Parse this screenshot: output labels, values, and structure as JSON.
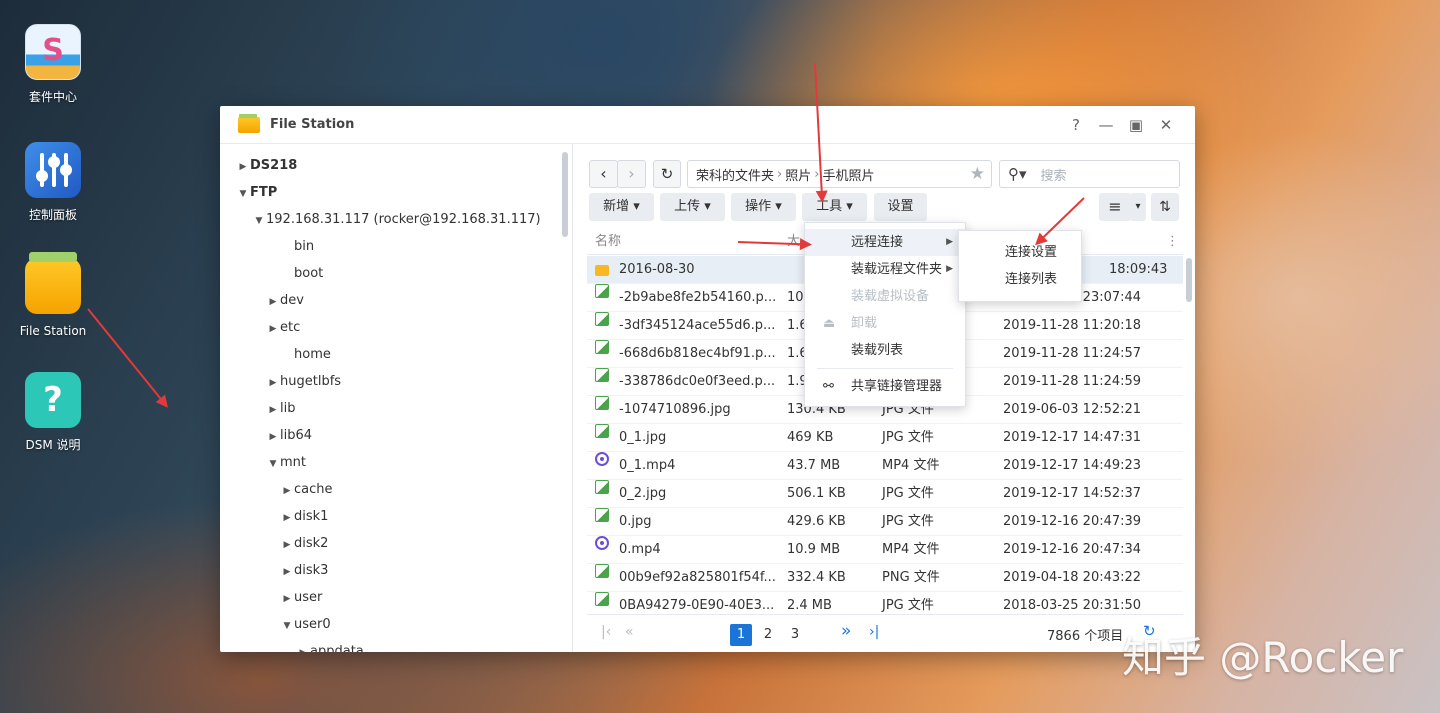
{
  "desktop": {
    "icons": [
      {
        "label": "套件中心",
        "icon": "package-center-icon"
      },
      {
        "label": "控制面板",
        "icon": "control-panel-icon"
      },
      {
        "label": "File Station",
        "icon": "folder-icon"
      },
      {
        "label": "DSM 说明",
        "icon": "help-icon"
      }
    ]
  },
  "window": {
    "title": "File Station",
    "controls": {
      "help": "?",
      "minimize": "—",
      "maximize": "▣",
      "close": "✕"
    }
  },
  "sidebar": {
    "items": [
      {
        "label": "DS218",
        "arrow": "▶"
      },
      {
        "label": "FTP",
        "arrow": "▼"
      },
      {
        "label": "192.168.31.117 (rocker@192.168.31.117)",
        "arrow": "▼"
      },
      {
        "label": "bin",
        "arrow": ""
      },
      {
        "label": "boot",
        "arrow": ""
      },
      {
        "label": "dev",
        "arrow": "▶"
      },
      {
        "label": "etc",
        "arrow": "▶"
      },
      {
        "label": "home",
        "arrow": ""
      },
      {
        "label": "hugetlbfs",
        "arrow": "▶"
      },
      {
        "label": "lib",
        "arrow": "▶"
      },
      {
        "label": "lib64",
        "arrow": "▶"
      },
      {
        "label": "mnt",
        "arrow": "▼"
      },
      {
        "label": "cache",
        "arrow": "▶"
      },
      {
        "label": "disk1",
        "arrow": "▶"
      },
      {
        "label": "disk2",
        "arrow": "▶"
      },
      {
        "label": "disk3",
        "arrow": "▶"
      },
      {
        "label": "user",
        "arrow": "▶"
      },
      {
        "label": "user0",
        "arrow": "▼"
      },
      {
        "label": "appdata",
        "arrow": "▶"
      }
    ]
  },
  "toolbar": {
    "back": "‹",
    "forward": "›",
    "refresh": "↻",
    "path": [
      "荣科的文件夹",
      "照片",
      "手机照片"
    ],
    "path_sep": "›",
    "star": "★",
    "search_placeholder": "搜索",
    "create": "新增 ▾",
    "upload": "上传 ▾",
    "action": "操作 ▾",
    "tools": "工具 ▾",
    "settings": "设置",
    "view_list": "≡",
    "view_dropdown": "▾",
    "sort": "⇅"
  },
  "table": {
    "columns": {
      "name": "名称",
      "size": "大",
      "more": "⋮"
    },
    "rows": [
      {
        "name": "2016-08-30",
        "size": "",
        "type": "",
        "modified": "18:09:43",
        "kind": "dir"
      },
      {
        "name": "-2b9abe8fe2b54160.p...",
        "size": "10",
        "type": "",
        "modified": "2019-11-03 23:07:44",
        "kind": "img"
      },
      {
        "name": "-3df345124ace55d6.p...",
        "size": "1.6",
        "type": "",
        "modified": "2019-11-28 11:20:18",
        "kind": "img"
      },
      {
        "name": "-668d6b818ec4bf91.p...",
        "size": "1.6",
        "type": "",
        "modified": "2019-11-28 11:24:57",
        "kind": "img"
      },
      {
        "name": "-338786dc0e0f3eed.p...",
        "size": "1.9",
        "type": "",
        "modified": "2019-11-28 11:24:59",
        "kind": "img"
      },
      {
        "name": "-1074710896.jpg",
        "size": "130.4 KB",
        "type": "JPG 文件",
        "modified": "2019-06-03 12:52:21",
        "kind": "img"
      },
      {
        "name": "0_1.jpg",
        "size": "469 KB",
        "type": "JPG 文件",
        "modified": "2019-12-17 14:47:31",
        "kind": "img"
      },
      {
        "name": "0_1.mp4",
        "size": "43.7 MB",
        "type": "MP4 文件",
        "modified": "2019-12-17 14:49:23",
        "kind": "vid"
      },
      {
        "name": "0_2.jpg",
        "size": "506.1 KB",
        "type": "JPG 文件",
        "modified": "2019-12-17 14:52:37",
        "kind": "img"
      },
      {
        "name": "0.jpg",
        "size": "429.6 KB",
        "type": "JPG 文件",
        "modified": "2019-12-16 20:47:39",
        "kind": "img"
      },
      {
        "name": "0.mp4",
        "size": "10.9 MB",
        "type": "MP4 文件",
        "modified": "2019-12-16 20:47:34",
        "kind": "vid"
      },
      {
        "name": "00b9ef92a825801f54f...",
        "size": "332.4 KB",
        "type": "PNG 文件",
        "modified": "2019-04-18 20:43:22",
        "kind": "img"
      },
      {
        "name": "0BA94279-0E90-40E3...",
        "size": "2.4 MB",
        "type": "JPG 文件",
        "modified": "2018-03-25 20:31:50",
        "kind": "img"
      }
    ]
  },
  "pagination": {
    "first": "|‹",
    "prev": "«",
    "pages": [
      "1",
      "2",
      "3"
    ],
    "current": "1",
    "next": "»",
    "last": "›|",
    "total": "7866 个项目",
    "refresh": "↻"
  },
  "tools_menu": {
    "items": [
      {
        "label": "远程连接",
        "submenu": true,
        "disabled": false,
        "icon": ""
      },
      {
        "label": "装载远程文件夹",
        "submenu": true,
        "disabled": false,
        "icon": ""
      },
      {
        "label": "装载虚拟设备",
        "submenu": false,
        "disabled": true,
        "icon": ""
      },
      {
        "label": "卸载",
        "submenu": false,
        "disabled": true,
        "icon": "⏏"
      },
      {
        "label": "装载列表",
        "submenu": false,
        "disabled": false,
        "icon": ""
      },
      {
        "label": "共享链接管理器",
        "submenu": false,
        "disabled": false,
        "icon": "⚯"
      }
    ],
    "submenu_arrow": "▶"
  },
  "remote_submenu": {
    "items": [
      "连接设置",
      "连接列表"
    ]
  },
  "watermark": "知乎 @Rocker",
  "colors": {
    "accent": "#1b74d8",
    "annotation": "#e23a3a"
  }
}
